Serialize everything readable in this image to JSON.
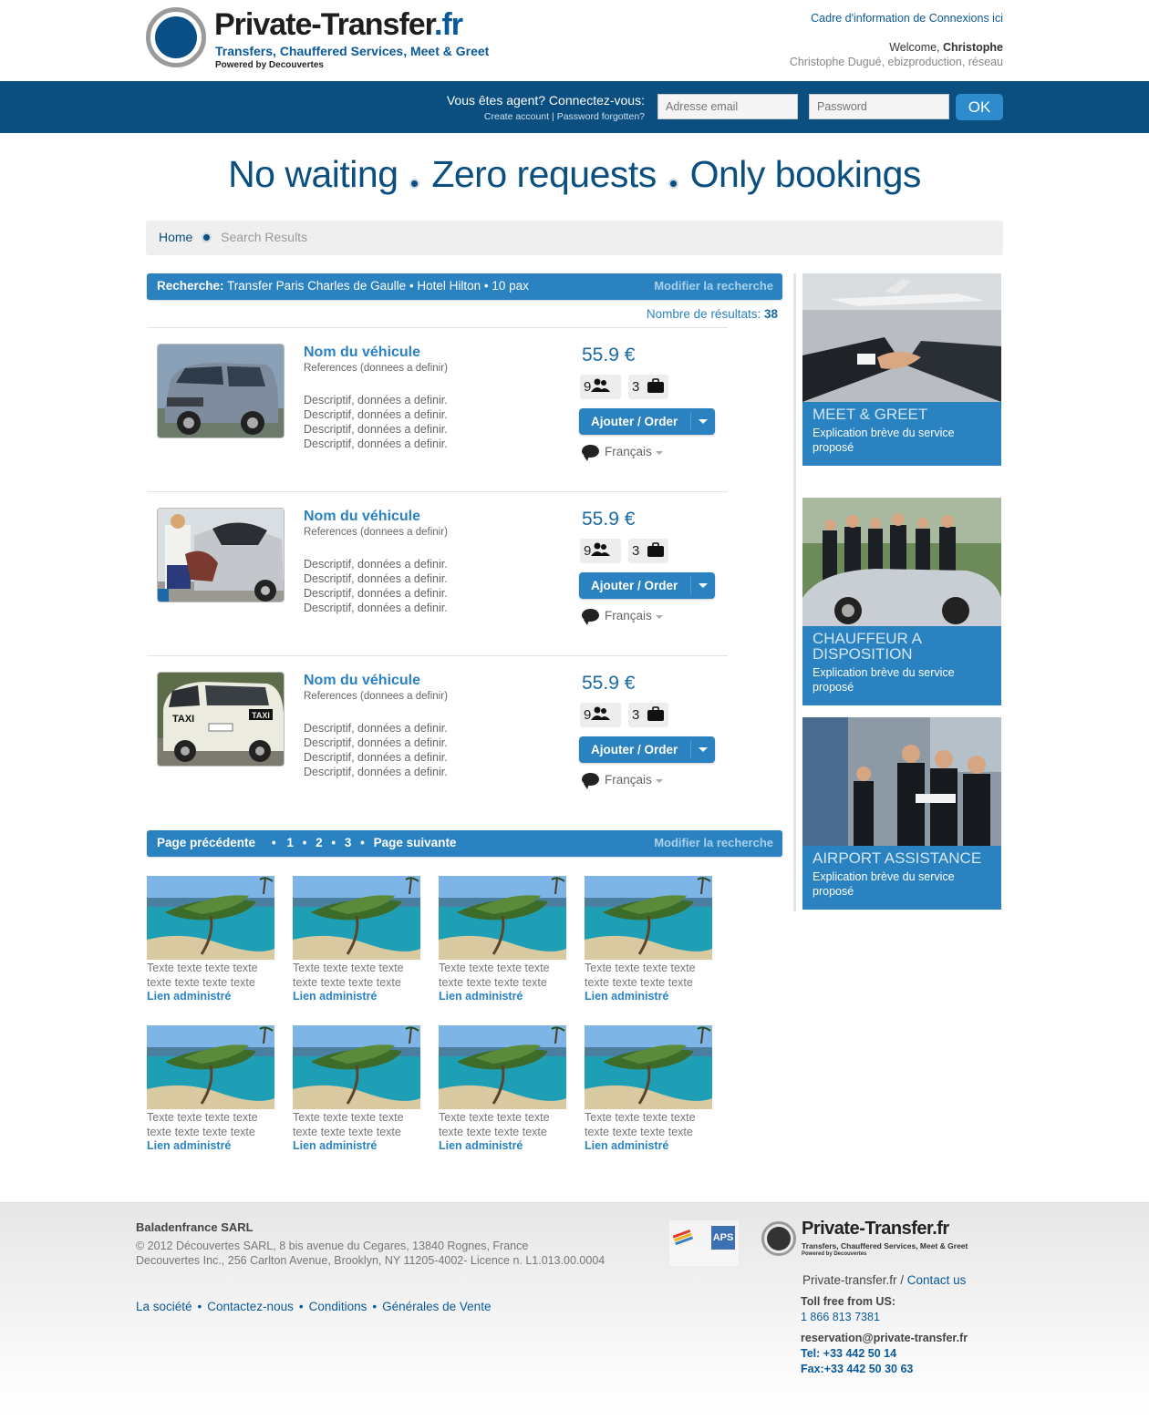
{
  "header": {
    "logo_title_main": "Private-Transfer",
    "logo_title_ext": ".fr",
    "logo_subtitle": "Transfers, Chauffered Services, Meet & Greet",
    "logo_powered": "Powered by Decouvertes",
    "info_link": "Cadre d'information de Connexions ici",
    "welcome_prefix": "Welcome, ",
    "welcome_name": "Christophe",
    "user_line": "Christophe Dugué, ebizproduction, réseau"
  },
  "loginbar": {
    "question": "Vous êtes agent? Connectez-vous:",
    "create_account": "Create account",
    "separator": " | ",
    "forgot": "Password forgotten?",
    "email_placeholder": "Adresse email",
    "password_placeholder": "Password",
    "ok_label": "OK"
  },
  "slogan": {
    "part1": "No waiting",
    "part2": "Zero requests",
    "part3": "Only bookings"
  },
  "breadcrumb": {
    "home": "Home",
    "current": "Search Results"
  },
  "search": {
    "label": "Recherche:",
    "query": " Transfer Paris Charles de Gaulle • Hotel Hilton • 10 pax",
    "modify": "Modifier la recherche",
    "count_label": "Nombre de résultats: ",
    "count": "38"
  },
  "results": [
    {
      "name": "Nom du véhicule",
      "ref": "References (donnees a definir)",
      "desc": [
        "Descriptif, données a definir.",
        "Descriptif, données a definir.",
        "Descriptif, données a definir.",
        "Descriptif, données a definir."
      ],
      "price": "55.9 €",
      "pax": "9",
      "bags": "3",
      "order": "Ajouter / Order",
      "lang": "Français",
      "image": "minivan"
    },
    {
      "name": "Nom du véhicule",
      "ref": "References (donnees a definir)",
      "desc": [
        "Descriptif, données a definir.",
        "Descriptif, données a definir.",
        "Descriptif, données a definir.",
        "Descriptif, données a definir."
      ],
      "price": "55.9 €",
      "pax": "9",
      "bags": "3",
      "order": "Ajouter / Order",
      "lang": "Français",
      "image": "car-trunk"
    },
    {
      "name": "Nom du véhicule",
      "ref": "References (donnees a definir)",
      "desc": [
        "Descriptif, données a definir.",
        "Descriptif, données a definir.",
        "Descriptif, données a definir.",
        "Descriptif, données a definir."
      ],
      "price": "55.9 €",
      "pax": "9",
      "bags": "3",
      "order": "Ajouter / Order",
      "lang": "Français",
      "image": "taxi"
    }
  ],
  "pagination": {
    "prev": "Page précédente",
    "bullet": "•",
    "pages": [
      "1",
      "2",
      "3"
    ],
    "next": "Page suivante",
    "modify": "Modifier la recherche"
  },
  "cards": [
    {
      "text1": "Texte texte texte texte",
      "text2": "texte texte  texte texte",
      "link": "Lien administré"
    },
    {
      "text1": "Texte texte texte texte",
      "text2": "texte texte  texte texte",
      "link": "Lien administré"
    },
    {
      "text1": "Texte texte texte texte",
      "text2": "texte texte  texte texte",
      "link": "Lien administré"
    },
    {
      "text1": "Texte texte texte texte",
      "text2": "texte texte  texte texte",
      "link": "Lien administré"
    },
    {
      "text1": "Texte texte texte texte",
      "text2": "texte texte  texte texte",
      "link": "Lien administré"
    },
    {
      "text1": "Texte texte texte texte",
      "text2": "texte texte  texte texte",
      "link": "Lien administré"
    },
    {
      "text1": "Texte texte texte texte",
      "text2": "texte texte  texte texte",
      "link": "Lien administré"
    },
    {
      "text1": "Texte texte texte texte",
      "text2": "texte texte  texte texte",
      "link": "Lien administré"
    }
  ],
  "services": [
    {
      "title": "MEET & GREET",
      "desc": "Explication brève du service proposé"
    },
    {
      "title": "CHAUFFEUR A DISPOSITION",
      "desc": "Explication brève du service proposé"
    },
    {
      "title": "AIRPORT ASSISTANCE",
      "desc": "Explication brève du service proposé"
    }
  ],
  "footer": {
    "company": "Baladenfrance SARL",
    "addr1": "© 2012 Découvertes SARL, 8 bis avenue du Cegares, 13840 Rognes, France",
    "addr2": "Decouvertes Inc., 256 Carlton Avenue, Brooklyn, NY 11205-4002- Licence n. L1.013.00.0004",
    "links": [
      "La société",
      "Contactez-nous",
      "Conditions",
      "Générales de Vente"
    ],
    "link_sep": "•",
    "badge2": "APS",
    "logo_main": "Private-Transfer",
    "logo_ext": ".fr",
    "logo_sub": "Transfers, Chauffered Services, Meet & Greet",
    "logo_powered": "Powered by Decouvertes",
    "site": "Private-transfer.fr / ",
    "contact": "Contact us",
    "tollfree_label": "Toll free from US:",
    "tollfree": "1 866 813 7381",
    "email": "reservation@private-transfer.fr",
    "tel": "Tel: +33 442 50 14",
    "fax": "Fax:+33 442 50 30 63"
  },
  "colors": {
    "brand_dark": "#0a4f80",
    "brand_blue": "#2a82c0"
  }
}
